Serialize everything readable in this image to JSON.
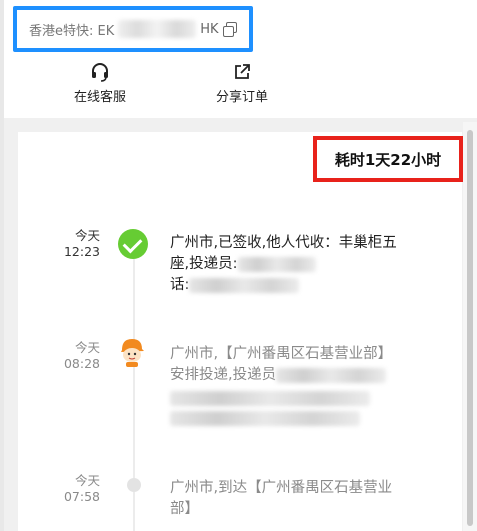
{
  "tracking": {
    "prefix": "香港e特快: EK",
    "suffix": "HK"
  },
  "actions": {
    "service_label": "在线客服",
    "share_label": "分享订单"
  },
  "summary": {
    "duration": "耗时1天22小时"
  },
  "events": [
    {
      "day": "今天",
      "time": "12:23",
      "line1": "广州市,已签收,他人代收：丰巢柜五",
      "line2": "座,投递员:",
      "line3": "话:"
    },
    {
      "day": "今天",
      "time": "08:28",
      "line1": "广州市,【广州番禺区石基营业部】",
      "line2": "安排投递,投递员"
    },
    {
      "day": "今天",
      "time": "07:58",
      "line1": "广州市,到达【广州番禺区石基营业",
      "line2": "部】"
    }
  ],
  "colors": {
    "highlight_blue": "#1e90ff",
    "highlight_red": "#e8221b",
    "status_green": "#66cc33"
  }
}
